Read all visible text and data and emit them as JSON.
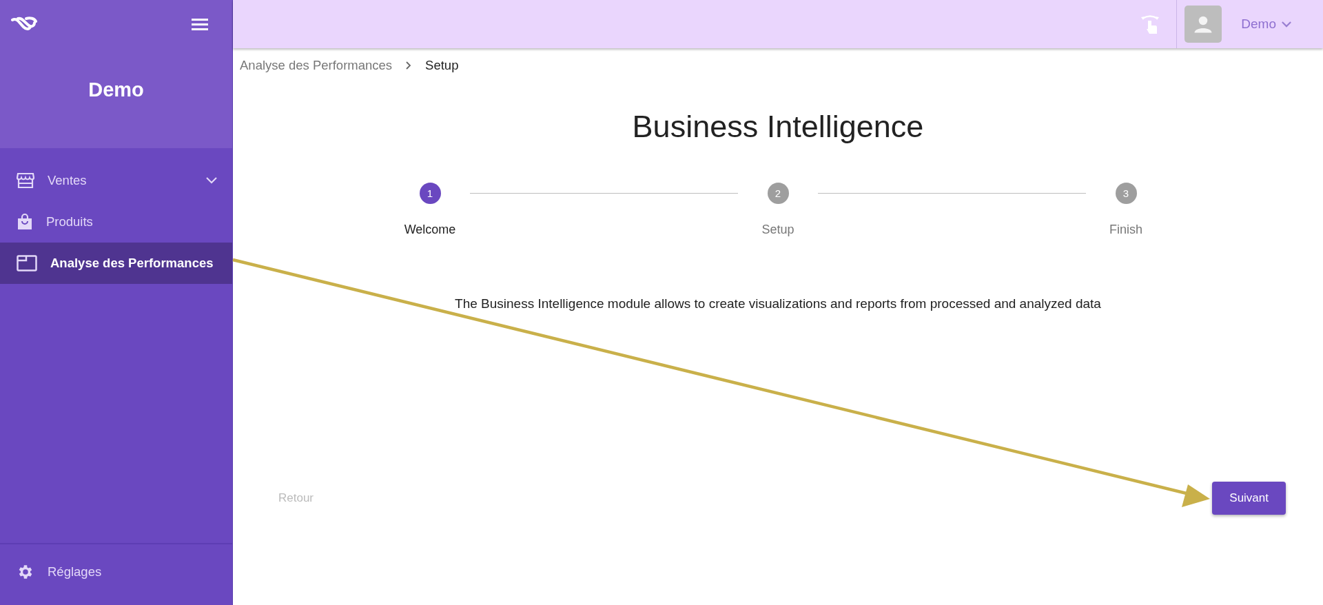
{
  "sidebar": {
    "workspace": "Demo",
    "items": [
      {
        "label": "Ventes",
        "expandable": true,
        "selected": false
      },
      {
        "label": "Produits",
        "expandable": false,
        "selected": false
      },
      {
        "label": "Analyse des Performances",
        "expandable": false,
        "selected": true
      }
    ],
    "footer_item": {
      "label": "Réglages"
    }
  },
  "header": {
    "user": "Demo"
  },
  "breadcrumb": [
    {
      "label": "Analyse des Performances",
      "current": false
    },
    {
      "label": "Setup",
      "current": true
    }
  ],
  "title": "Business Intelligence",
  "steps": [
    {
      "number": "1",
      "label": "Welcome",
      "selected": true
    },
    {
      "number": "2",
      "label": "Setup",
      "selected": false
    },
    {
      "number": "3",
      "label": "Finish",
      "selected": false
    }
  ],
  "description": "The Business Intelligence module allows to create visualizations and reports from processed and analyzed data",
  "buttons": {
    "back": {
      "label": "Retour",
      "disabled": true
    },
    "next": {
      "label": "Suivant",
      "disabled": false
    }
  }
}
